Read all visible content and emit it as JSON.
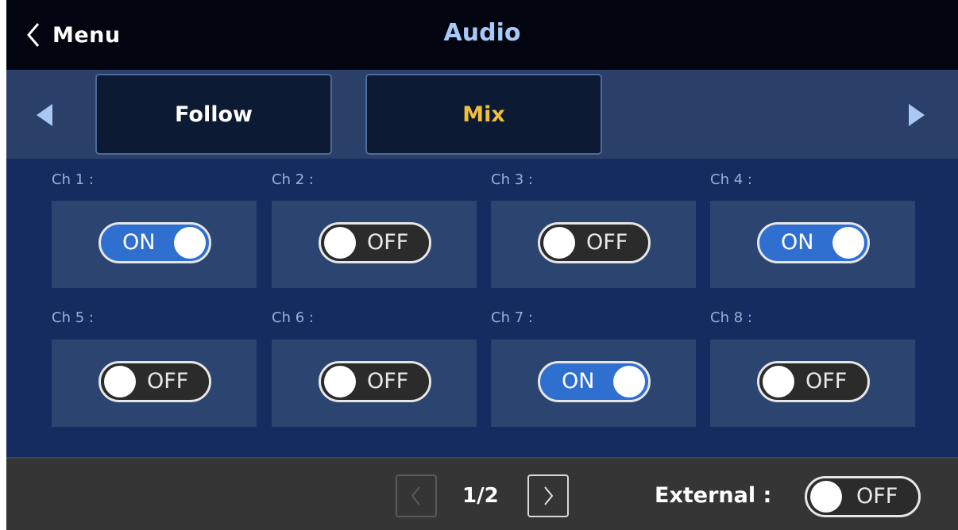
{
  "header": {
    "back_label": "Menu",
    "title": "Audio"
  },
  "tabs": [
    {
      "label": "Follow",
      "active": false
    },
    {
      "label": "Mix",
      "active": true
    }
  ],
  "channels": [
    {
      "label": "Ch 1 :",
      "state": "ON"
    },
    {
      "label": "Ch 2 :",
      "state": "OFF"
    },
    {
      "label": "Ch 3 :",
      "state": "OFF"
    },
    {
      "label": "Ch 4 :",
      "state": "ON"
    },
    {
      "label": "Ch 5 :",
      "state": "OFF"
    },
    {
      "label": "Ch 6 :",
      "state": "OFF"
    },
    {
      "label": "Ch 7 :",
      "state": "ON"
    },
    {
      "label": "Ch 8 :",
      "state": "OFF"
    }
  ],
  "footer": {
    "page": "1/2",
    "external_label": "External :",
    "external_state": "OFF"
  },
  "icons": {
    "back": "chevron-left-icon",
    "tab_prev": "triangle-left-icon",
    "tab_next": "triangle-right-icon",
    "page_prev": "chevron-left-icon",
    "page_next": "chevron-right-icon"
  },
  "colors": {
    "header_bg": "#02050f",
    "title": "#a8c8f5",
    "tab_active_text": "#f0bf3c",
    "toggle_on": "#2f6fd0",
    "toggle_off": "#2b2b2b",
    "channels_bg": "#142c5f",
    "footer_bg": "#353535"
  }
}
